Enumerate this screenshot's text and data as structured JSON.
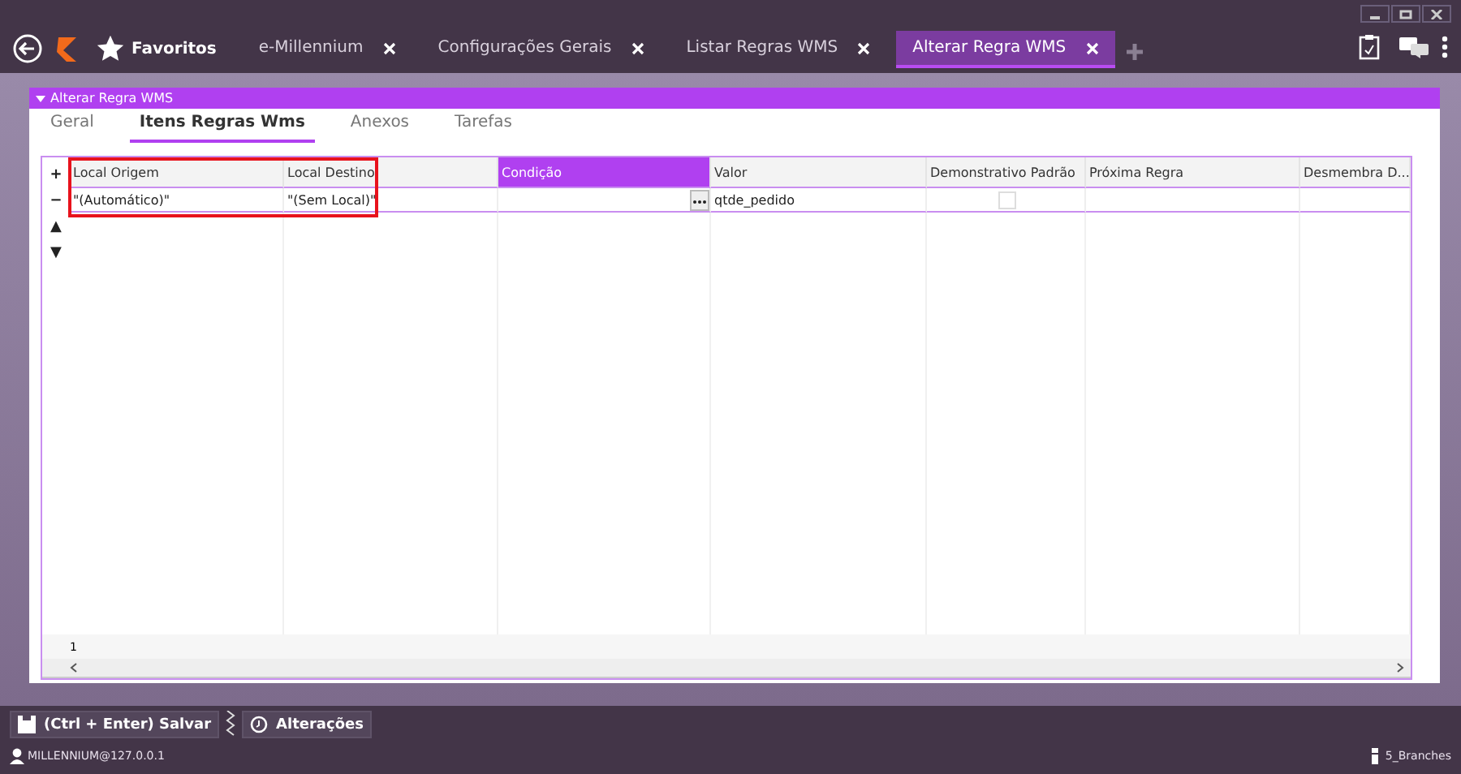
{
  "favorites": "Favoritos",
  "tabs": [
    {
      "label": "e-Millennium",
      "selected": false
    },
    {
      "label": "Configurações Gerais",
      "selected": false
    },
    {
      "label": "Listar Regras WMS",
      "selected": false
    },
    {
      "label": "Alterar Regra WMS",
      "selected": true
    }
  ],
  "panel": {
    "title": "Alterar Regra WMS"
  },
  "inner_tabs": [
    {
      "label": "Geral",
      "selected": false
    },
    {
      "label": "Itens Regras Wms",
      "selected": true
    },
    {
      "label": "Anexos",
      "selected": false
    },
    {
      "label": "Tarefas",
      "selected": false
    }
  ],
  "grid": {
    "columns": [
      {
        "label": "Local Origem",
        "selected": false,
        "kind": "text"
      },
      {
        "label": "Local Destino",
        "selected": false,
        "kind": "text"
      },
      {
        "label": "Condição",
        "selected": true,
        "kind": "ellipsis"
      },
      {
        "label": "Valor",
        "selected": false,
        "kind": "text"
      },
      {
        "label": "Demonstrativo Padrão",
        "selected": false,
        "kind": "check"
      },
      {
        "label": "Próxima Regra",
        "selected": false,
        "kind": "text"
      },
      {
        "label": "Desmembra D...",
        "selected": false,
        "kind": "text"
      }
    ],
    "rows": [
      {
        "cells": [
          "\"(Automático)\"",
          "\"(Sem Local)\"",
          "",
          "qtde_pedido",
          false,
          "",
          ""
        ]
      }
    ],
    "row_buttons": [
      "+",
      "−",
      "▲",
      "▼"
    ],
    "count": "1"
  },
  "footer": {
    "save": "(Ctrl + Enter) Salvar",
    "changes": "Alterações",
    "user": "MILLENNIUM@127.0.0.1",
    "branch": "5_Branches"
  }
}
